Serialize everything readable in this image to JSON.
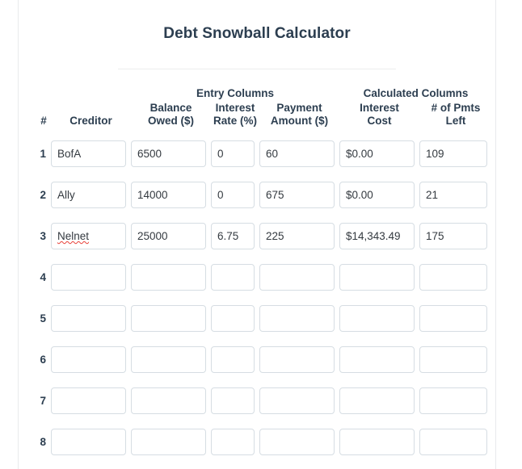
{
  "page": {
    "title": "Debt Snowball Calculator"
  },
  "table": {
    "group_headers": {
      "row_num": "",
      "creditor": "",
      "entry": "Entry Columns",
      "calculated": "Calculated Columns"
    },
    "columns": {
      "row_num": "#",
      "creditor": "Creditor",
      "balance_owed_l1": "Balance",
      "balance_owed_l2": "Owed ($)",
      "interest_rate_l1": "Interest",
      "interest_rate_l2": "Rate (%)",
      "payment_amount_l1": "Payment",
      "payment_amount_l2": "Amount ($)",
      "interest_cost_l1": "Interest",
      "interest_cost_l2": "Cost",
      "pmts_left_l1": "# of Pmts",
      "pmts_left_l2": "Left"
    },
    "rows": [
      {
        "num": "1",
        "creditor": "BofA",
        "balance_owed": "6500",
        "interest_rate": "0",
        "payment_amount": "60",
        "interest_cost": "$0.00",
        "pmts_left": "109",
        "misspelled": false
      },
      {
        "num": "2",
        "creditor": "Ally",
        "balance_owed": "14000",
        "interest_rate": "0",
        "payment_amount": "675",
        "interest_cost": "$0.00",
        "pmts_left": "21",
        "misspelled": false
      },
      {
        "num": "3",
        "creditor": "Nelnet",
        "balance_owed": "25000",
        "interest_rate": "6.75",
        "payment_amount": "225",
        "interest_cost": "$14,343.49",
        "pmts_left": "175",
        "misspelled": true
      },
      {
        "num": "4",
        "creditor": "",
        "balance_owed": "",
        "interest_rate": "",
        "payment_amount": "",
        "interest_cost": "",
        "pmts_left": "",
        "misspelled": false
      },
      {
        "num": "5",
        "creditor": "",
        "balance_owed": "",
        "interest_rate": "",
        "payment_amount": "",
        "interest_cost": "",
        "pmts_left": "",
        "misspelled": false
      },
      {
        "num": "6",
        "creditor": "",
        "balance_owed": "",
        "interest_rate": "",
        "payment_amount": "",
        "interest_cost": "",
        "pmts_left": "",
        "misspelled": false
      },
      {
        "num": "7",
        "creditor": "",
        "balance_owed": "",
        "interest_rate": "",
        "payment_amount": "",
        "interest_cost": "",
        "pmts_left": "",
        "misspelled": false
      },
      {
        "num": "8",
        "creditor": "",
        "balance_owed": "",
        "interest_rate": "",
        "payment_amount": "",
        "interest_cost": "",
        "pmts_left": "",
        "misspelled": false
      }
    ]
  },
  "colors": {
    "title": "#2c3e50",
    "input_border": "#d6dde3",
    "divider": "#eceded",
    "card_border": "#e9eaec",
    "spellcheck_underline": "#e8413a",
    "text": "#343a40"
  }
}
